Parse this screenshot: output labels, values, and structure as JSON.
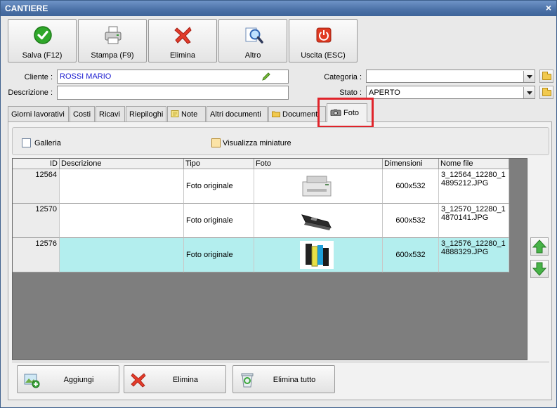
{
  "window": {
    "title": "CANTIERE",
    "close": "×"
  },
  "toolbar": {
    "save": "Salva (F12)",
    "print": "Stampa (F9)",
    "delete": "Elimina",
    "other": "Altro",
    "exit": "Uscita (ESC)"
  },
  "form": {
    "client_label": "Cliente :",
    "client_value": "ROSSI MARIO",
    "description_label": "Descrizione :",
    "description_value": "",
    "category_label": "Categoria :",
    "category_value": "",
    "status_label": "Stato :",
    "status_value": "APERTO"
  },
  "tabs": [
    "Giorni lavorativi",
    "Costi",
    "Ricavi",
    "Riepiloghi",
    "Note",
    "Altri documenti",
    "Documenti",
    "Foto"
  ],
  "active_tab": "Foto",
  "options": {
    "gallery": "Galleria",
    "thumbnails": "Visualizza miniature"
  },
  "grid": {
    "columns": [
      "ID",
      "Descrizione",
      "Tipo",
      "Foto",
      "Dimensioni",
      "Nome file"
    ],
    "rows": [
      {
        "id": "12564",
        "description": "",
        "type": "Foto originale",
        "photo": "printer",
        "dimensions": "600x532",
        "file": "3_12564_12280_14895212.JPG",
        "file_l1": "3_12564_12280_1",
        "file_l2": "4895212.JPG"
      },
      {
        "id": "12570",
        "description": "",
        "type": "Foto originale",
        "photo": "toner-cartridge",
        "dimensions": "600x532",
        "file": "3_12570_12280_14870141.JPG",
        "file_l1": "3_12570_12280_1",
        "file_l2": "4870141.JPG"
      },
      {
        "id": "12576",
        "description": "",
        "type": "Foto originale",
        "photo": "ink-cartridges",
        "dimensions": "600x532",
        "file": "3_12576_12280_14888329.JPG",
        "file_l1": "3_12576_12280_1",
        "file_l2": "4888329.JPG"
      }
    ],
    "selected_row": 2
  },
  "bottom": {
    "add": "Aggiungi",
    "delete": "Elimina",
    "delete_all": "Elimina tutto"
  },
  "colors": {
    "titlebar": "#4d73a9",
    "highlight": "#e0242b",
    "selected_row": "#b3eeee"
  }
}
